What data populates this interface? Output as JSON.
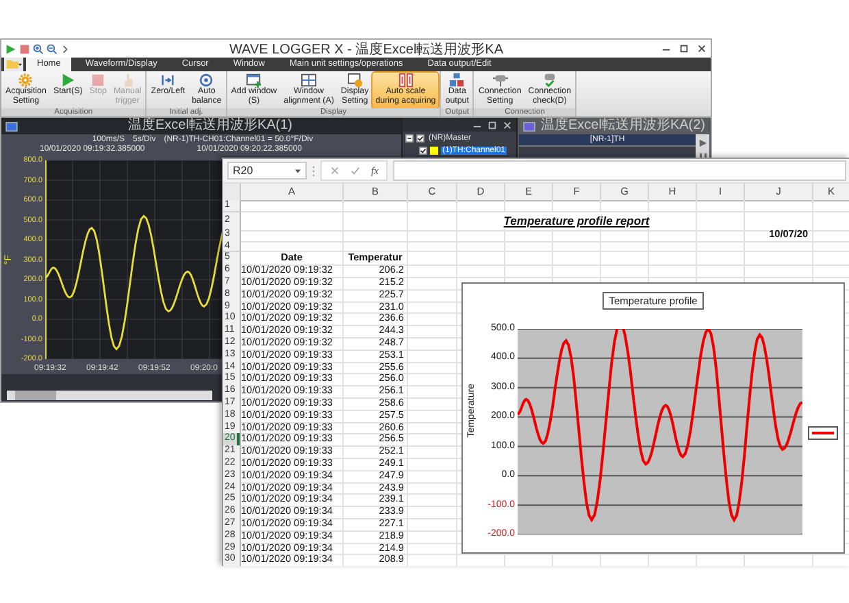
{
  "wave_logger": {
    "title": "WAVE LOGGER X - 温度Excel転送用波形KA",
    "tabs": [
      {
        "label": "Home",
        "selected": true
      },
      {
        "label": "Waveform/Display",
        "selected": false
      },
      {
        "label": "Cursor",
        "selected": false
      },
      {
        "label": "Window",
        "selected": false
      },
      {
        "label": "Main unit settings/operations",
        "selected": false
      },
      {
        "label": "Data output/Edit",
        "selected": false
      }
    ],
    "ribbon_groups": [
      {
        "label": "Acquisition",
        "buttons": [
          {
            "label": "Acquisition\nSetting",
            "disabled": false,
            "selected": false
          },
          {
            "label": "Start(S)",
            "disabled": false,
            "selected": false
          },
          {
            "label": "Stop",
            "disabled": true,
            "selected": false
          },
          {
            "label": "Manual\ntrigger",
            "disabled": true,
            "selected": false
          }
        ]
      },
      {
        "label": "Initial adj.",
        "buttons": [
          {
            "label": "Zero/Left",
            "disabled": false,
            "selected": false
          },
          {
            "label": "Auto\nbalance",
            "disabled": false,
            "selected": false
          }
        ]
      },
      {
        "label": "Display",
        "buttons": [
          {
            "label": "Add window\n(S)",
            "disabled": false,
            "selected": false
          },
          {
            "label": "Window\nalignment (A)",
            "disabled": false,
            "selected": false
          },
          {
            "label": "Display\nSetting",
            "disabled": false,
            "selected": false
          },
          {
            "label": "Auto scale\nduring acquiring",
            "disabled": false,
            "selected": true
          }
        ]
      },
      {
        "label": "Output",
        "buttons": [
          {
            "label": "Data\noutput",
            "disabled": false,
            "selected": false
          }
        ]
      },
      {
        "label": "Connection",
        "buttons": [
          {
            "label": "Connection\nSetting",
            "disabled": false,
            "selected": false
          },
          {
            "label": "Connection\ncheck(D)",
            "disabled": false,
            "selected": false
          }
        ]
      }
    ],
    "graph_window": {
      "title": "温度Excel転送用波形KA(1)",
      "scale_items": [
        "100ms/S",
        "5s/Div",
        "(NR-1)TH-CH01:Channel01 = 50.0°F/Div"
      ],
      "start_time": "10/01/2020 09:19:32.385000",
      "end_time": "10/01/2020 09:20:22.385000",
      "unit": "°F",
      "y_ticks": [
        "800.0",
        "700.0",
        "600.0",
        "500.0",
        "400.0",
        "300.0",
        "200.0",
        "100.0",
        "0.0",
        "-100.0",
        "-200.0"
      ],
      "x_ticks": [
        "09:19:32",
        "09:19:42",
        "09:19:52",
        "09:20:0"
      ]
    },
    "channel_tree": [
      {
        "label": "(NR)Master",
        "checked": true,
        "expanded": true,
        "children": [
          {
            "label": "(1)TH:Channel01",
            "checked": true,
            "selected": true,
            "color": "#ffff00"
          }
        ]
      }
    ],
    "monitor_window": {
      "title": "温度Excel転送用波形KA(2)",
      "channel": "[NR-1]TH"
    }
  },
  "spreadsheet": {
    "name_box": "R20",
    "formula_label": "fx",
    "columns": [
      "A",
      "B",
      "C",
      "D",
      "E",
      "F",
      "G",
      "H",
      "I",
      "J",
      "K"
    ],
    "rows": [
      {
        "number": "1",
        "kind": "blank",
        "selected": false
      },
      {
        "number": "2",
        "kind": "title",
        "selected": false,
        "text": "Temperature profile report"
      },
      {
        "number": "3",
        "kind": "date",
        "selected": false,
        "text": "10/07/20"
      },
      {
        "number": "4",
        "kind": "blank",
        "selected": false
      },
      {
        "number": "5",
        "kind": "header",
        "selected": false,
        "cells": [
          "Date",
          "Temperatur"
        ]
      },
      {
        "number": "6",
        "kind": "data",
        "selected": false,
        "cells": [
          "10/01/2020 09:19:32",
          "206.2"
        ]
      },
      {
        "number": "7",
        "kind": "data",
        "selected": false,
        "cells": [
          "10/01/2020 09:19:32",
          "215.2"
        ]
      },
      {
        "number": "8",
        "kind": "data",
        "selected": false,
        "cells": [
          "10/01/2020 09:19:32",
          "225.7"
        ]
      },
      {
        "number": "9",
        "kind": "data",
        "selected": false,
        "cells": [
          "10/01/2020 09:19:32",
          "231.0"
        ]
      },
      {
        "number": "10",
        "kind": "data",
        "selected": false,
        "cells": [
          "10/01/2020 09:19:32",
          "236.6"
        ]
      },
      {
        "number": "11",
        "kind": "data",
        "selected": false,
        "cells": [
          "10/01/2020 09:19:32",
          "244.3"
        ]
      },
      {
        "number": "12",
        "kind": "data",
        "selected": false,
        "cells": [
          "10/01/2020 09:19:32",
          "248.7"
        ]
      },
      {
        "number": "13",
        "kind": "data",
        "selected": false,
        "cells": [
          "10/01/2020 09:19:33",
          "253.1"
        ]
      },
      {
        "number": "14",
        "kind": "data",
        "selected": false,
        "cells": [
          "10/01/2020 09:19:33",
          "255.6"
        ]
      },
      {
        "number": "15",
        "kind": "data",
        "selected": false,
        "cells": [
          "10/01/2020 09:19:33",
          "256.0"
        ]
      },
      {
        "number": "16",
        "kind": "data",
        "selected": false,
        "cells": [
          "10/01/2020 09:19:33",
          "256.1"
        ]
      },
      {
        "number": "17",
        "kind": "data",
        "selected": false,
        "cells": [
          "10/01/2020 09:19:33",
          "258.6"
        ]
      },
      {
        "number": "18",
        "kind": "data",
        "selected": false,
        "cells": [
          "10/01/2020 09:19:33",
          "257.5"
        ]
      },
      {
        "number": "19",
        "kind": "data",
        "selected": false,
        "cells": [
          "10/01/2020 09:19:33",
          "260.6"
        ]
      },
      {
        "number": "20",
        "kind": "data",
        "selected": true,
        "cells": [
          "10/01/2020 09:19:33",
          "256.5"
        ]
      },
      {
        "number": "21",
        "kind": "data",
        "selected": false,
        "cells": [
          "10/01/2020 09:19:33",
          "252.1"
        ]
      },
      {
        "number": "22",
        "kind": "data",
        "selected": false,
        "cells": [
          "10/01/2020 09:19:33",
          "249.1"
        ]
      },
      {
        "number": "23",
        "kind": "data",
        "selected": false,
        "cells": [
          "10/01/2020 09:19:34",
          "247.9"
        ]
      },
      {
        "number": "24",
        "kind": "data",
        "selected": false,
        "cells": [
          "10/01/2020 09:19:34",
          "243.9"
        ]
      },
      {
        "number": "25",
        "kind": "data",
        "selected": false,
        "cells": [
          "10/01/2020 09:19:34",
          "239.1"
        ]
      },
      {
        "number": "26",
        "kind": "data",
        "selected": false,
        "cells": [
          "10/01/2020 09:19:34",
          "233.9"
        ]
      },
      {
        "number": "27",
        "kind": "data",
        "selected": false,
        "cells": [
          "10/01/2020 09:19:34",
          "227.1"
        ]
      },
      {
        "number": "28",
        "kind": "data",
        "selected": false,
        "cells": [
          "10/01/2020 09:19:34",
          "218.9"
        ]
      },
      {
        "number": "29",
        "kind": "data",
        "selected": false,
        "cells": [
          "10/01/2020 09:19:34",
          "214.9"
        ]
      },
      {
        "number": "30",
        "kind": "data",
        "selected": false,
        "cells": [
          "10/01/2020 09:19:34",
          "208.9"
        ]
      }
    ],
    "chart": {
      "title": "Temperature profile",
      "ylabel": "Temperature",
      "y_ticks": [
        {
          "label": "500.0",
          "negative": false
        },
        {
          "label": "400.0",
          "negative": false
        },
        {
          "label": "300.0",
          "negative": false
        },
        {
          "label": "200.0",
          "negative": false
        },
        {
          "label": "100.0",
          "negative": false
        },
        {
          "label": "0.0",
          "negative": false
        },
        {
          "label": "-100.0",
          "negative": true
        },
        {
          "label": "-200.0",
          "negative": true
        }
      ]
    }
  }
}
